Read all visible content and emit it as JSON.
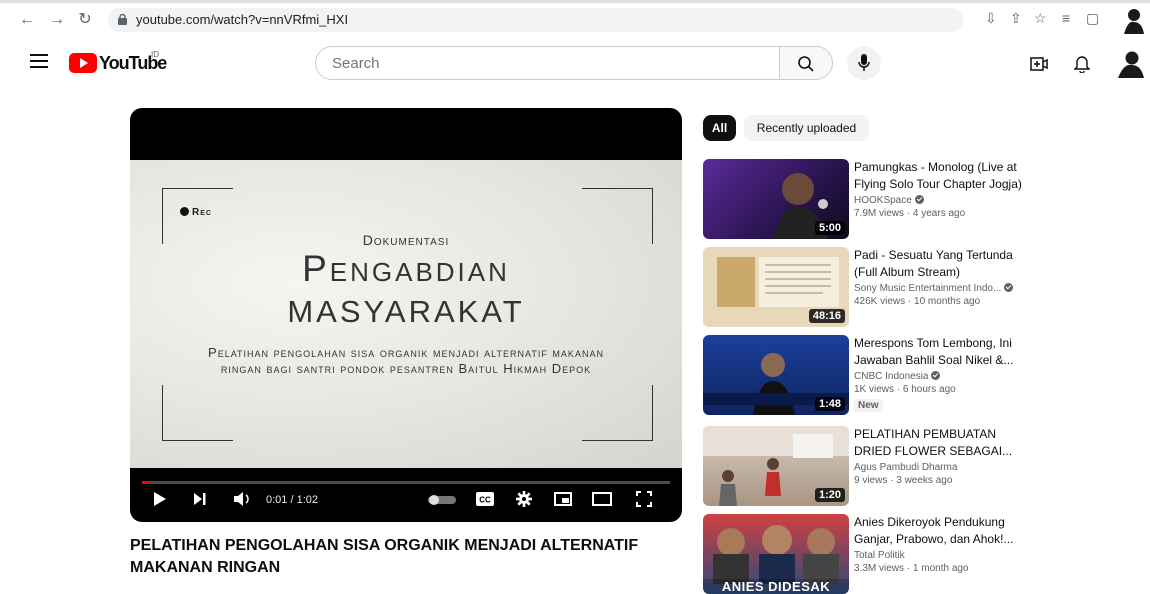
{
  "browser": {
    "url": "youtube.com/watch?v=nnVRfmi_HXI"
  },
  "header": {
    "logo_text": "YouTube",
    "region": "ID",
    "search_placeholder": "Search"
  },
  "player": {
    "rec_label": "Rec",
    "line1": "Dokumentasi",
    "line2": "Pengabdian",
    "line3": "MASYARAKAT",
    "line4": "Pelatihan pengolahan sisa organik menjadi alternatif makanan ringan bagi santri pondok pesantren Baitul Hikmah Depok",
    "time": "0:01 / 1:02",
    "progress": 0.016
  },
  "video": {
    "title": "PELATIHAN PENGOLAHAN SISA ORGANIK MENJADI ALTERNATIF MAKANAN RINGAN"
  },
  "chips": [
    "All",
    "Recently uploaded"
  ],
  "recommendations": [
    {
      "title": "Pamungkas - Monolog (Live at Flying Solo Tour Chapter Jogja)",
      "channel": "HOOKSpace",
      "verified": true,
      "stats": "7.9M views · 4 years ago",
      "duration": "5:00",
      "badge": "",
      "thumb_color": "#3a1f6e"
    },
    {
      "title": "Padi - Sesuatu Yang Tertunda (Full Album Stream)",
      "channel": "Sony Music Entertainment Indo...",
      "verified": true,
      "stats": "426K views · 10 months ago",
      "duration": "48:16",
      "badge": "",
      "thumb_color": "#d8c9a3"
    },
    {
      "title": "Merespons Tom Lembong, Ini Jawaban Bahlil Soal Nikel &...",
      "channel": "CNBC Indonesia",
      "verified": true,
      "stats": "1K views · 6 hours ago",
      "duration": "1:48",
      "badge": "New",
      "thumb_color": "#1c3a8c"
    },
    {
      "title": "PELATIHAN PEMBUATAN DRIED FLOWER SEBAGAI...",
      "channel": "Agus Pambudi Dharma",
      "verified": false,
      "stats": "9 views · 3 weeks ago",
      "duration": "1:20",
      "badge": "",
      "thumb_color": "#b9a89a"
    },
    {
      "title": "Anies Dikeroyok Pendukung Ganjar, Prabowo, dan Ahok!...",
      "channel": "Total Politik",
      "verified": false,
      "stats": "3.3M views · 1 month ago",
      "duration": "",
      "badge": "",
      "thumb_overlay": "ANIES DIDESAK",
      "thumb_color": "#2a4a7a"
    }
  ]
}
